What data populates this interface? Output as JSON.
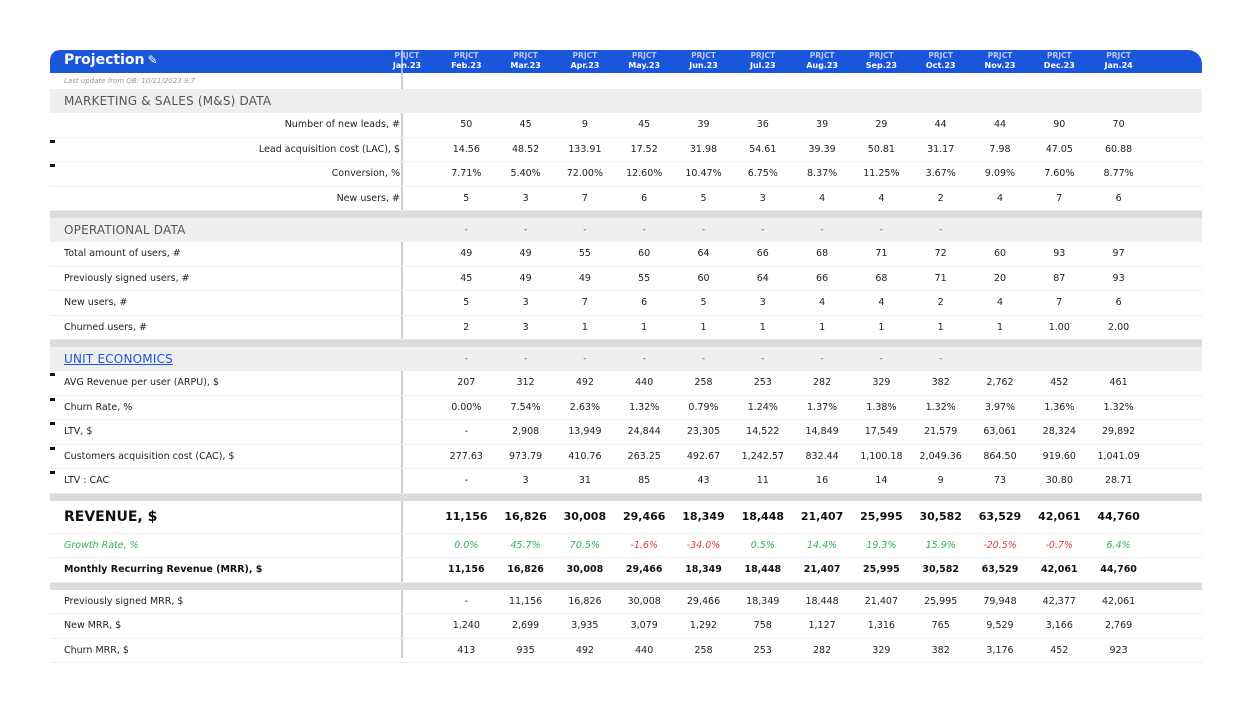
{
  "header": {
    "title": "Projection",
    "title_icon": "pencil-icon",
    "prefix": "PRJCT",
    "months": [
      "Jan.23",
      "Feb.23",
      "Mar.23",
      "Apr.23",
      "May.23",
      "Jun.23",
      "Jul.23",
      "Aug.23",
      "Sep.23",
      "Oct.23",
      "Nov.23",
      "Dec.23",
      "Jan.24"
    ]
  },
  "last_update": "Last update from QB: 10/11/2023 9:7",
  "marketing": {
    "title": "MARKETING & SALES (M&S) DATA",
    "rows": [
      {
        "label": "Number of new leads, #",
        "values": [
          "50",
          "45",
          "9",
          "45",
          "39",
          "36",
          "39",
          "29",
          "44",
          "44",
          "90",
          "70"
        ]
      },
      {
        "label": "Lead acquisition cost (LAC), $",
        "values": [
          "14.56",
          "48.52",
          "133.91",
          "17.52",
          "31.98",
          "54.61",
          "39.39",
          "50.81",
          "31.17",
          "7.98",
          "47.05",
          "60.88"
        ]
      },
      {
        "label": "Conversion, %",
        "values": [
          "7.71%",
          "5.40%",
          "72.00%",
          "12.60%",
          "10.47%",
          "6.75%",
          "8.37%",
          "11.25%",
          "3.67%",
          "9.09%",
          "7.60%",
          "8.77%"
        ]
      },
      {
        "label": "New users, #",
        "values": [
          "5",
          "3",
          "7",
          "6",
          "5",
          "3",
          "4",
          "4",
          "2",
          "4",
          "7",
          "6"
        ]
      }
    ]
  },
  "operational": {
    "title": "OPERATIONAL DATA",
    "dashes": [
      "-",
      "-",
      "-",
      "-",
      "-",
      "-",
      "-",
      "-",
      "-",
      "",
      "",
      ""
    ],
    "rows": [
      {
        "label": "Total amount of users, #",
        "values": [
          "49",
          "49",
          "55",
          "60",
          "64",
          "66",
          "68",
          "71",
          "72",
          "60",
          "93",
          "97"
        ]
      },
      {
        "label": "Previously signed users, #",
        "values": [
          "45",
          "49",
          "49",
          "55",
          "60",
          "64",
          "66",
          "68",
          "71",
          "20",
          "87",
          "93"
        ]
      },
      {
        "label": "New users, #",
        "values": [
          "5",
          "3",
          "7",
          "6",
          "5",
          "3",
          "4",
          "4",
          "2",
          "4",
          "7",
          "6"
        ]
      },
      {
        "label": "Churned users, #",
        "values": [
          "2",
          "3",
          "1",
          "1",
          "1",
          "1",
          "1",
          "1",
          "1",
          "1",
          "1.00",
          "2.00"
        ]
      }
    ]
  },
  "unit_economics": {
    "title": "UNIT ECONOMICS",
    "dashes": [
      "-",
      "-",
      "-",
      "-",
      "-",
      "-",
      "-",
      "-",
      "-",
      "",
      "",
      ""
    ],
    "rows": [
      {
        "label": "AVG Revenue per user (ARPU), $",
        "values": [
          "207",
          "312",
          "492",
          "440",
          "258",
          "253",
          "282",
          "329",
          "382",
          "2,762",
          "452",
          "461"
        ]
      },
      {
        "label": "Churn Rate, %",
        "values": [
          "0.00%",
          "7.54%",
          "2.63%",
          "1.32%",
          "0.79%",
          "1.24%",
          "1.37%",
          "1.38%",
          "1.32%",
          "3.97%",
          "1.36%",
          "1.32%"
        ]
      },
      {
        "label": "LTV, $",
        "values": [
          "-",
          "2,908",
          "13,949",
          "24,844",
          "23,305",
          "14,522",
          "14,849",
          "17,549",
          "21,579",
          "63,061",
          "28,324",
          "29,892"
        ]
      },
      {
        "label": "Customers acquisition cost (CAC), $",
        "values": [
          "277.63",
          "973.79",
          "410.76",
          "263.25",
          "492.67",
          "1,242.57",
          "832.44",
          "1,100.18",
          "2,049.36",
          "864.50",
          "919.60",
          "1,041.09"
        ]
      },
      {
        "label": "LTV : CAC",
        "values": [
          "-",
          "3",
          "31",
          "85",
          "43",
          "11",
          "16",
          "14",
          "9",
          "73",
          "30.80",
          "28.71"
        ]
      }
    ]
  },
  "revenue": {
    "title": "REVENUE, $",
    "values": [
      "11,156",
      "16,826",
      "30,008",
      "29,466",
      "18,349",
      "18,448",
      "21,407",
      "25,995",
      "30,582",
      "63,529",
      "42,061",
      "44,760"
    ],
    "growth_label": "Growth Rate, %",
    "growth": [
      "0.0%",
      "45.7%",
      "70.5%",
      "-1.6%",
      "-34.0%",
      "0.5%",
      "14.4%",
      "19.3%",
      "15.9%",
      "-20.5%",
      "-0.7%",
      "6.4%"
    ],
    "mrr_label": "Monthly Recurring Revenue (MRR), $",
    "mrr": [
      "11,156",
      "16,826",
      "30,008",
      "29,466",
      "18,349",
      "18,448",
      "21,407",
      "25,995",
      "30,582",
      "63,529",
      "42,061",
      "44,760"
    ]
  },
  "mrr_detail": {
    "rows": [
      {
        "label": "Previously signed MRR, $",
        "values": [
          "-",
          "11,156",
          "16,826",
          "30,008",
          "29,466",
          "18,349",
          "18,448",
          "21,407",
          "25,995",
          "79,948",
          "42,377",
          "42,061"
        ]
      },
      {
        "label": "New MRR, $",
        "values": [
          "1,240",
          "2,699",
          "3,935",
          "3,079",
          "1,292",
          "758",
          "1,127",
          "1,316",
          "765",
          "9,529",
          "3,166",
          "2,769"
        ]
      },
      {
        "label": "Churn MRR, $",
        "values": [
          "413",
          "935",
          "492",
          "440",
          "258",
          "253",
          "282",
          "329",
          "382",
          "3,176",
          "452",
          "923"
        ]
      }
    ]
  },
  "colors": {
    "accent": "#1a56db",
    "positive": "#2fb34f",
    "negative": "#e23b3b"
  }
}
